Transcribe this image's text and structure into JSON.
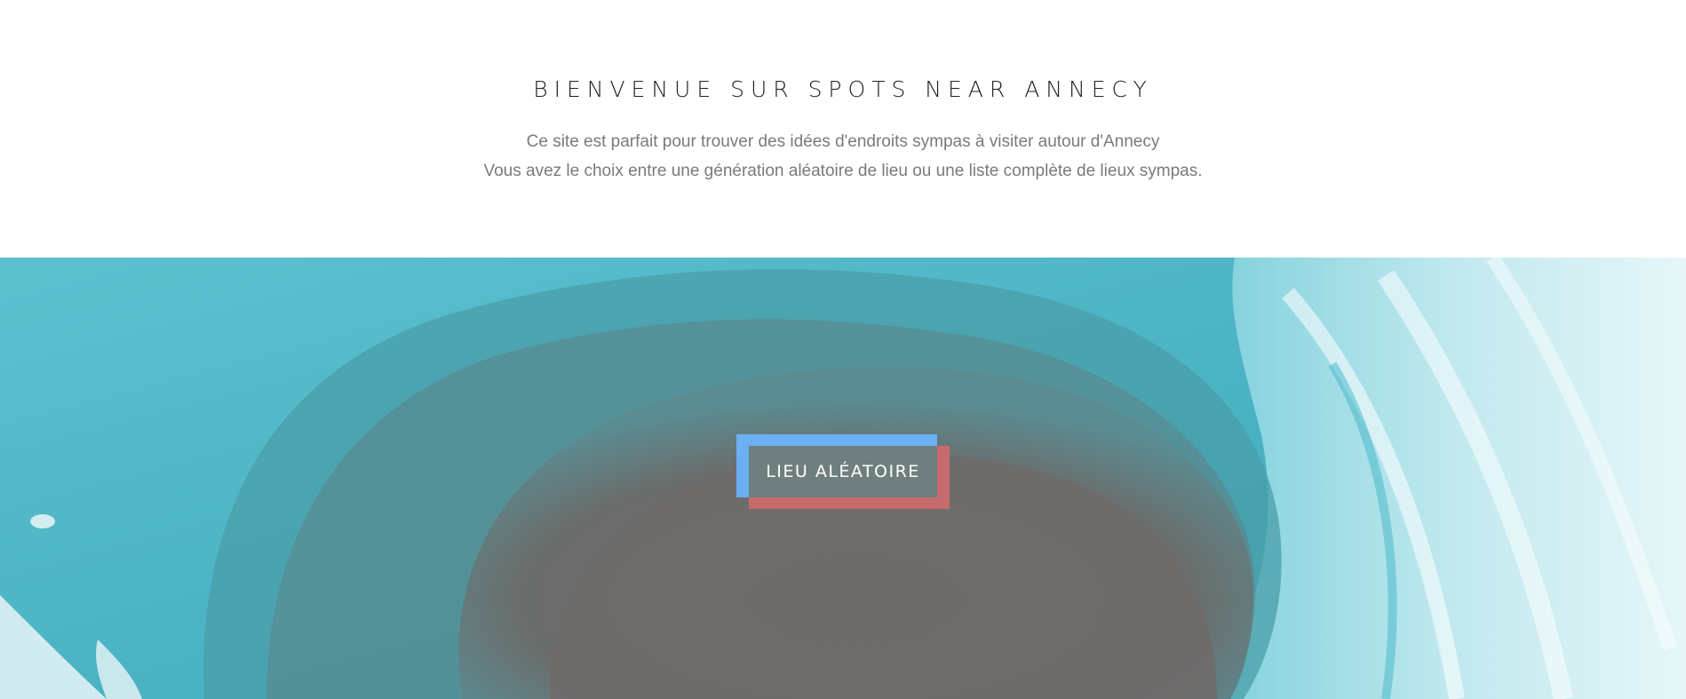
{
  "intro": {
    "title": "BIENVENUE SUR SPOTS NEAR ANNECY",
    "line1": "Ce site est parfait pour trouver des idées d'endroits sympas à visiter autour d'Annecy",
    "line2": "Vous avez le choix entre une génération aléatoire de lieu ou une liste complète de lieux sympas."
  },
  "hero": {
    "button_label": "LIEU ALÉATOIRE"
  },
  "colors": {
    "teal": "#4fb4c4",
    "dark_center": "#6e6b6a",
    "button_blue": "#6ab0f3",
    "button_red": "#c76a6c",
    "button_face": "#6f7f80"
  }
}
